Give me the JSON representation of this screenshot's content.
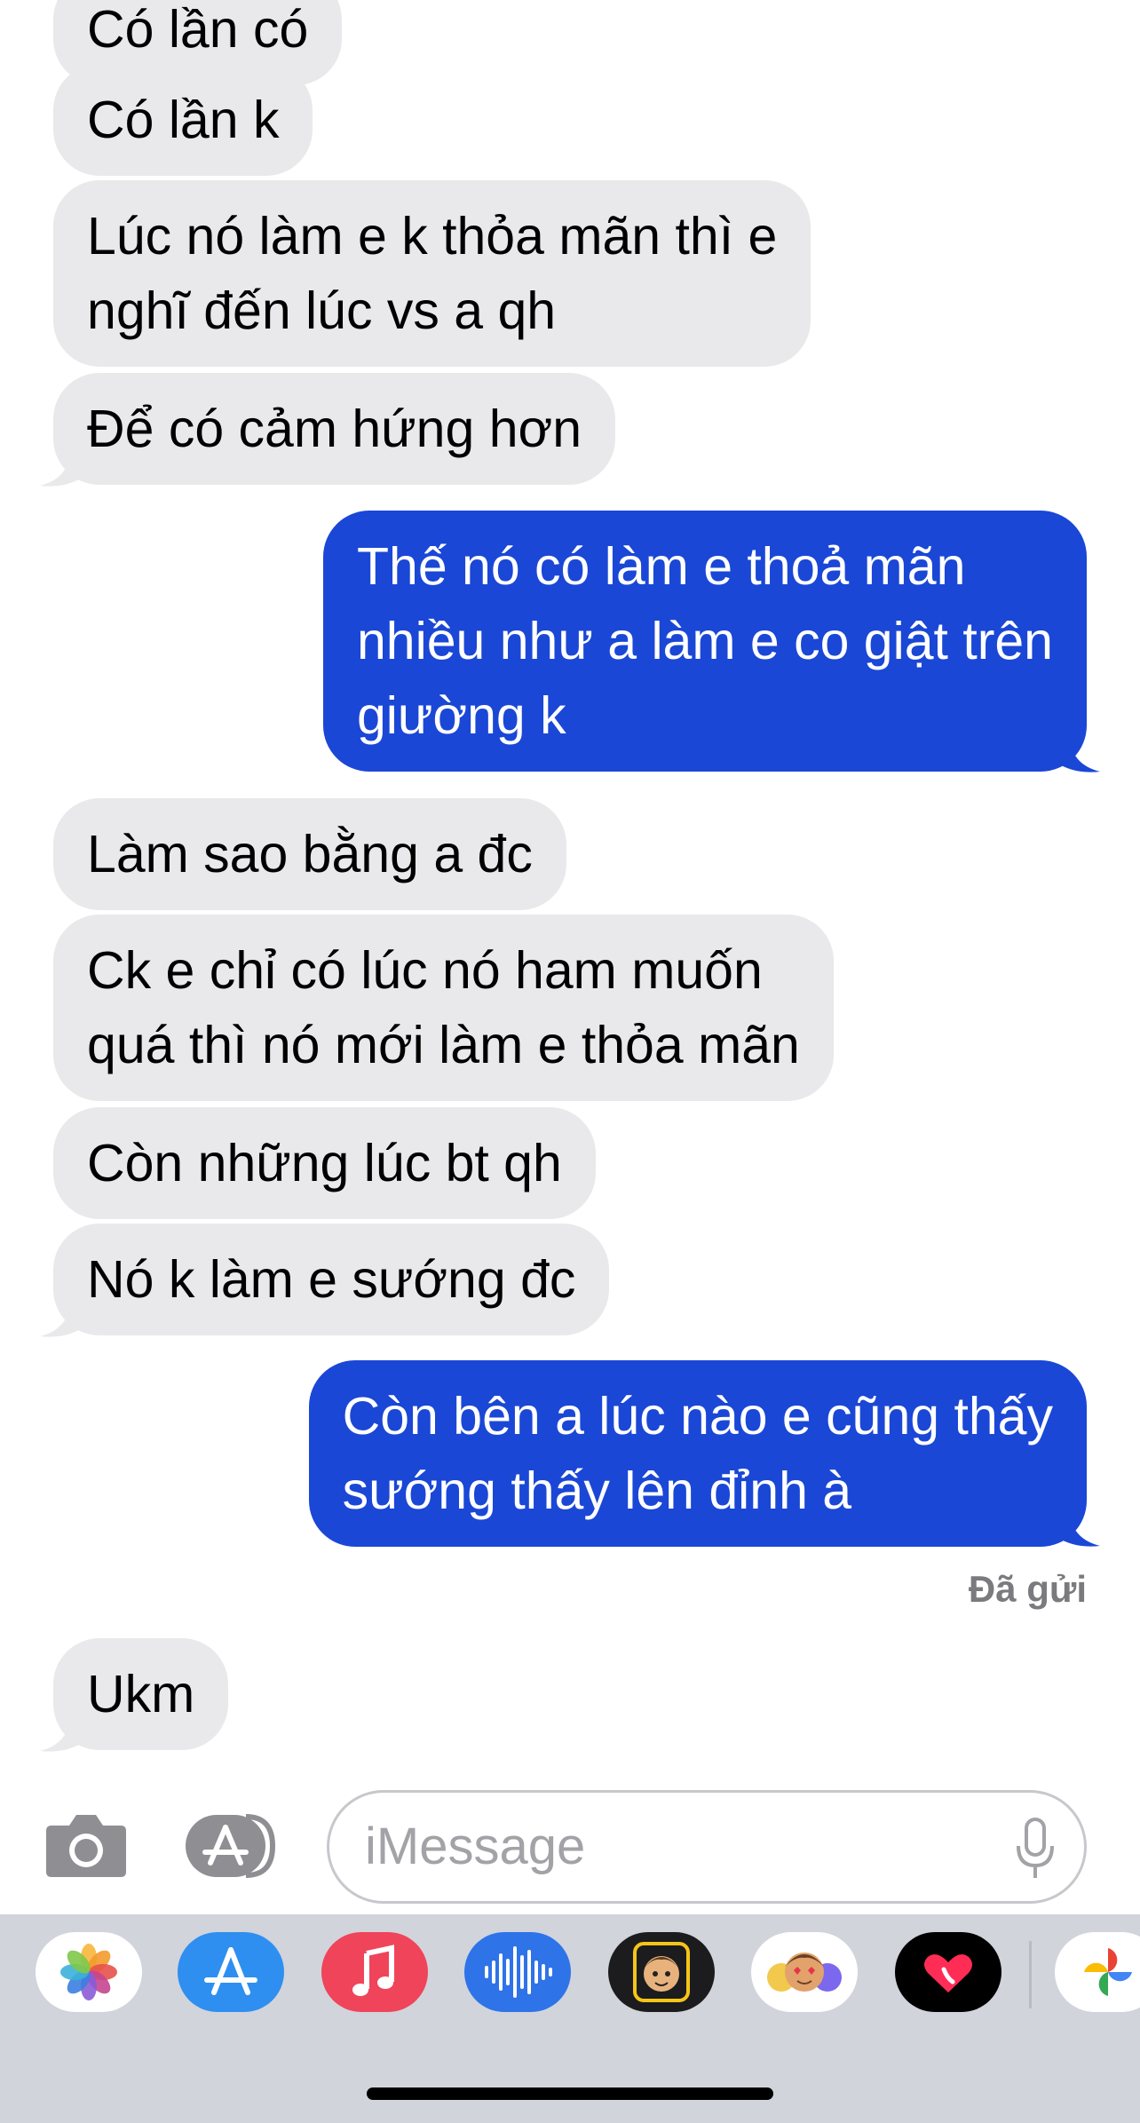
{
  "messages": [
    {
      "dir": "in",
      "text": "Có lần có"
    },
    {
      "dir": "in",
      "text": "Có lần k"
    },
    {
      "dir": "in",
      "text": "Lúc nó làm e k thỏa mãn thì e\nnghĩ đến lúc vs a qh"
    },
    {
      "dir": "in",
      "text": "Để có cảm hứng hơn"
    },
    {
      "dir": "out",
      "text": "Thế nó có làm e thoả mãn\nnhiều như a làm e co giật trên\ngiường k"
    },
    {
      "dir": "in",
      "text": "Làm sao bằng a đc"
    },
    {
      "dir": "in",
      "text": "Ck e chỉ có lúc nó ham muốn\nquá thì nó mới làm e thỏa mãn"
    },
    {
      "dir": "in",
      "text": "Còn những lúc bt qh"
    },
    {
      "dir": "in",
      "text": "Nó k làm e sướng đc"
    },
    {
      "dir": "out",
      "text": "Còn bên a lúc nào e cũng thấy\nsướng thấy lên đỉnh à"
    },
    {
      "dir": "in",
      "text": "Ukm"
    }
  ],
  "status": {
    "delivered": "Đã gửi"
  },
  "input": {
    "placeholder": "iMessage"
  },
  "icons": {
    "camera": "camera-icon",
    "apps": "app-store-icon",
    "mic": "microphone-icon"
  },
  "drawer_apps": [
    {
      "name": "photos-app-icon"
    },
    {
      "name": "app-store-app-icon"
    },
    {
      "name": "music-app-icon"
    },
    {
      "name": "audio-message-app-icon"
    },
    {
      "name": "memoji-app-icon"
    },
    {
      "name": "animoji-stickers-app-icon"
    },
    {
      "name": "digital-touch-app-icon"
    },
    {
      "name": "google-photos-app-icon"
    }
  ],
  "colors": {
    "incoming_bubble": "#e9e9eb",
    "outgoing_bubble": "#1a47d6",
    "drawer_bg": "#d1d4db"
  }
}
